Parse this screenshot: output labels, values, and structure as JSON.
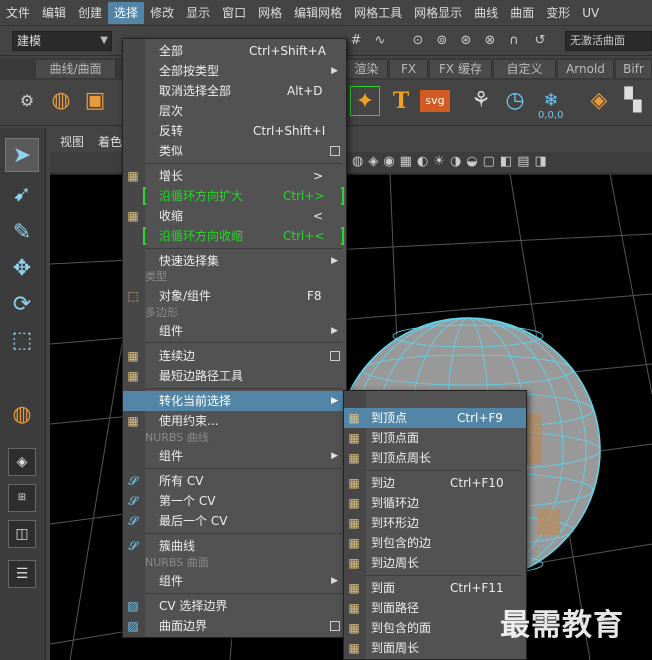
{
  "menubar": [
    "文件",
    "编辑",
    "创建",
    "选择",
    "修改",
    "显示",
    "窗口",
    "网格",
    "编辑网格",
    "网格工具",
    "网格显示",
    "曲线",
    "曲面",
    "变形",
    "UV"
  ],
  "status": {
    "mode": "建模",
    "no_surface": "无激活曲面"
  },
  "shelf": {
    "tabs": [
      "曲线/曲面",
      "渲染",
      "FX",
      "FX 缓存",
      "自定义",
      "Arnold",
      "Bifr"
    ],
    "text_icon": "T",
    "svg_icon": "svg",
    "count_icon": "0,0,0"
  },
  "panel": {
    "view": "视图",
    "shading": "着色"
  },
  "select_menu": {
    "items": {
      "all": {
        "label": "全部",
        "acc": "Ctrl+Shift+A"
      },
      "all_by_type": {
        "label": "全部按类型"
      },
      "deselect_all": {
        "label": "取消选择全部",
        "acc": "Alt+D"
      },
      "hierarchy": {
        "label": "层次"
      },
      "invert": {
        "label": "反转",
        "acc": "Ctrl+Shift+I"
      },
      "similar": {
        "label": "类似"
      },
      "grow": {
        "label": "增长",
        "acc": ">"
      },
      "grow_along_loop": {
        "label": "沿循环方向扩大",
        "acc": "Ctrl+>"
      },
      "shrink": {
        "label": "收缩",
        "acc": "<"
      },
      "shrink_along_loop": {
        "label": "沿循环方向收缩",
        "acc": "Ctrl+<"
      },
      "quick_select_sets": {
        "label": "快速选择集"
      },
      "type_section": {
        "label": "类型"
      },
      "object_component": {
        "label": "对象/组件",
        "acc": "F8"
      },
      "polygon_section": {
        "label": "多边形"
      },
      "component": {
        "label": "组件"
      },
      "contiguous_edges": {
        "label": "连续边"
      },
      "shortest_edge_path": {
        "label": "最短边路径工具"
      },
      "convert_selection": {
        "label": "转化当前选择"
      },
      "use_constraints": {
        "label": "使用约束..."
      },
      "nurbs_curve_section": {
        "label": "NURBS 曲线"
      },
      "component_2": {
        "label": "组件"
      },
      "all_cv": {
        "label": "所有 CV"
      },
      "first_cv": {
        "label": "第一个 CV"
      },
      "last_cv": {
        "label": "最后一个 CV"
      },
      "cluster_curve": {
        "label": "簇曲线"
      },
      "nurbs_surface_section": {
        "label": "NURBS 曲面"
      },
      "component_3": {
        "label": "组件"
      },
      "cv_selection_boundary": {
        "label": "CV 选择边界"
      },
      "surface_border": {
        "label": "曲面边界"
      }
    }
  },
  "convert_menu": {
    "items": {
      "to_vertices": {
        "label": "到顶点",
        "acc": "Ctrl+F9"
      },
      "to_vertex_faces": {
        "label": "到顶点面"
      },
      "to_vertex_perimeter": {
        "label": "到顶点周长"
      },
      "to_edges": {
        "label": "到边",
        "acc": "Ctrl+F10"
      },
      "to_edge_loop": {
        "label": "到循环边"
      },
      "to_edge_ring": {
        "label": "到环形边"
      },
      "to_contained_edges": {
        "label": "到包含的边"
      },
      "to_edge_perimeter": {
        "label": "到边周长"
      },
      "to_faces": {
        "label": "到面",
        "acc": "Ctrl+F11"
      },
      "to_face_path": {
        "label": "到面路径"
      },
      "to_contained_faces": {
        "label": "到包含的面"
      },
      "to_face_perimeter": {
        "label": "到面周长"
      }
    }
  },
  "watermark": "最需教育",
  "colors": {
    "highlight": "#5285a6",
    "green": "#29d629",
    "wire": "#5fd6ee"
  }
}
